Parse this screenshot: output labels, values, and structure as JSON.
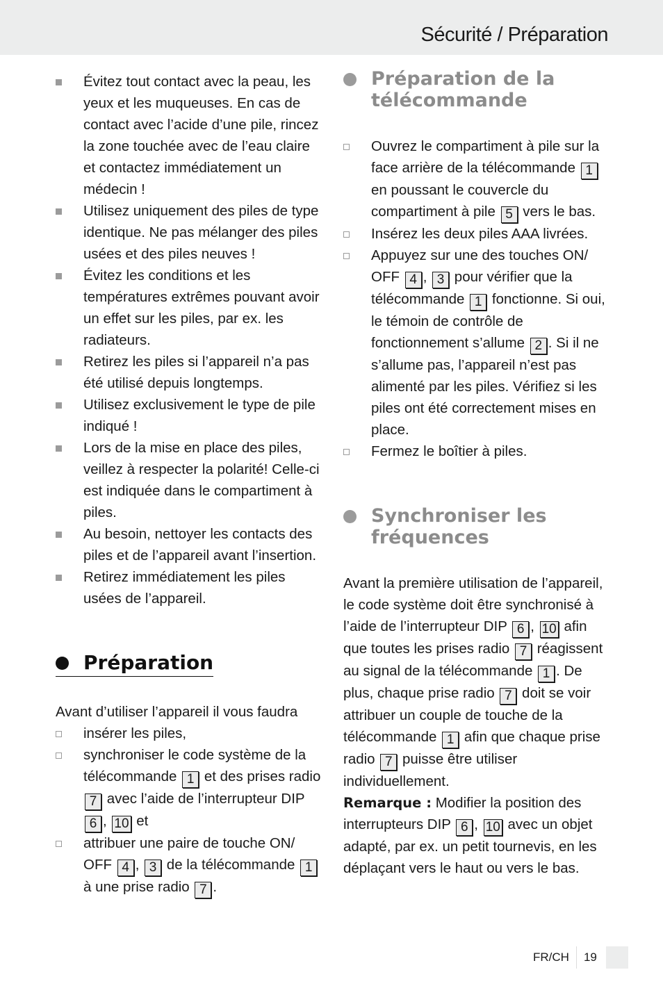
{
  "header": {
    "title": "Sécurité / Préparation"
  },
  "left_column": {
    "safety_bullets": [
      [
        "Évitez tout contact avec la peau, les yeux et les muqueuses. En cas de contact avec l’acide d’une pile, rincez la zone touchée avec de l’eau claire et contactez immédiatement un médecin !"
      ],
      [
        "Utilisez uniquement des piles de type identique. Ne pas mélanger des piles usées et des piles neuves !"
      ],
      [
        "Évitez les conditions et les températures extrêmes pouvant avoir un effet sur les piles, par ex. les radiateurs."
      ],
      [
        "Retirez les piles si l’appareil n’a pas été utilisé depuis longtemps."
      ],
      [
        "Utilisez exclusivement le type de pile indiqué !"
      ],
      [
        "Lors de la mise en place des piles, veillez à respecter la polarité! Celle-ci est indiquée dans le compartiment à piles."
      ],
      [
        "Au besoin, nettoyer les contacts des piles et de l’appareil avant l’insertion."
      ],
      [
        "Retirez immédiatement les piles usées de l’appareil."
      ]
    ],
    "preparation": {
      "heading": "Préparation",
      "intro": "Avant d’utiliser l’appareil il vous faudra",
      "steps": [
        [
          {
            "t": "insérer les piles,"
          }
        ],
        [
          {
            "t": "synchroniser le code système de la télécommande "
          },
          {
            "ref": "1"
          },
          {
            "t": " et des prises radio "
          },
          {
            "ref": "7"
          },
          {
            "t": " avec l’aide de l’interrupteur DIP "
          },
          {
            "ref": "6"
          },
          {
            "t": ", "
          },
          {
            "ref": "10"
          },
          {
            "t": " et"
          }
        ],
        [
          {
            "t": "attribuer une paire de touche ON/ OFF "
          },
          {
            "ref": "4"
          },
          {
            "t": ", "
          },
          {
            "ref": "3"
          },
          {
            "t": " de la télécommande "
          },
          {
            "ref": "1"
          },
          {
            "t": " à une prise radio "
          },
          {
            "ref": "7"
          },
          {
            "t": "."
          }
        ]
      ]
    }
  },
  "right_column": {
    "remote_prep": {
      "heading": "Préparation de la télécommande",
      "steps": [
        [
          {
            "t": "Ouvrez le compartiment à pile sur la face arrière de la télécommande "
          },
          {
            "ref": "1"
          },
          {
            "t": " en poussant le couvercle du compartiment à pile "
          },
          {
            "ref": "5"
          },
          {
            "t": " vers le bas."
          }
        ],
        [
          {
            "t": "Insérez les deux piles AAA livrées."
          }
        ],
        [
          {
            "t": "Appuyez sur une des touches ON/ OFF "
          },
          {
            "ref": "4"
          },
          {
            "t": ", "
          },
          {
            "ref": "3"
          },
          {
            "t": " pour vérifier que la télécommande "
          },
          {
            "ref": "1"
          },
          {
            "t": " fonctionne. Si oui, le témoin de contrôle de fonctionnement s’allume "
          },
          {
            "ref": "2"
          },
          {
            "t": ". Si il ne s’allume pas, l’appareil n’est pas alimenté par les piles. Vérifiez si les piles ont été correctement mises en place."
          }
        ],
        [
          {
            "t": "Fermez le boîtier à piles."
          }
        ]
      ]
    },
    "sync": {
      "heading": "Synchroniser les fréquences",
      "body": [
        {
          "t": "Avant la première utilisation de l’appareil, le code système doit être synchronisé à l’aide de l’interrupteur DIP "
        },
        {
          "ref": "6"
        },
        {
          "t": ", "
        },
        {
          "ref": "10"
        },
        {
          "t": " afin que toutes les prises radio "
        },
        {
          "ref": "7"
        },
        {
          "t": " réagissent au signal de la télécommande "
        },
        {
          "ref": "1"
        },
        {
          "t": ". De plus, chaque prise radio "
        },
        {
          "ref": "7"
        },
        {
          "t": " doit se voir attribuer un couple de touche de la télécommande "
        },
        {
          "ref": "1"
        },
        {
          "t": " afin que chaque prise radio "
        },
        {
          "ref": "7"
        },
        {
          "t": " puisse être utiliser individuellement."
        }
      ],
      "note_label": "Remarque :",
      "note": [
        {
          "t": " Modifier la position des interrupteurs DIP "
        },
        {
          "ref": "6"
        },
        {
          "t": ", "
        },
        {
          "ref": "10"
        },
        {
          "t": " avec un objet adapté, par ex. un petit tournevis, en les déplaçant vers le haut ou vers le bas."
        }
      ]
    }
  },
  "footer": {
    "lang": "FR/CH",
    "page": "19"
  }
}
